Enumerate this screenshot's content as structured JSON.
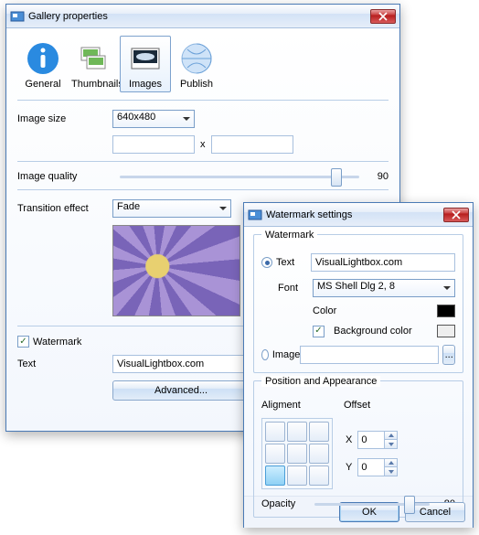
{
  "main": {
    "title": "Gallery properties",
    "tabs": {
      "general": "General",
      "thumbnails": "Thumbnails",
      "images": "Images",
      "publish": "Publish"
    },
    "image_size_label": "Image size",
    "image_size_value": "640x480",
    "dim_x": "x",
    "quality_label": "Image quality",
    "quality_value": "90",
    "transition_label": "Transition effect",
    "transition_value": "Fade",
    "watermark_label": "Watermark",
    "text_label": "Text",
    "text_value": "VisualLightbox.com",
    "advanced_btn": "Advanced..."
  },
  "wm": {
    "title": "Watermark settings",
    "group_watermark": "Watermark",
    "radio_text": "Text",
    "text_value": "VisualLightbox.com",
    "font_label": "Font",
    "font_value": "MS Shell Dlg 2, 8",
    "color_label": "Color",
    "color_value": "#000000",
    "bgcolor_label": "Background color",
    "radio_image": "Image",
    "browse_btn": "...",
    "group_pos": "Position and Appearance",
    "align_label": "Aligment",
    "offset_label": "Offset",
    "x_label": "X",
    "x_value": "0",
    "y_label": "Y",
    "y_value": "0",
    "opacity_label": "Opacity",
    "opacity_value": "80",
    "ok": "OK",
    "cancel": "Cancel"
  }
}
